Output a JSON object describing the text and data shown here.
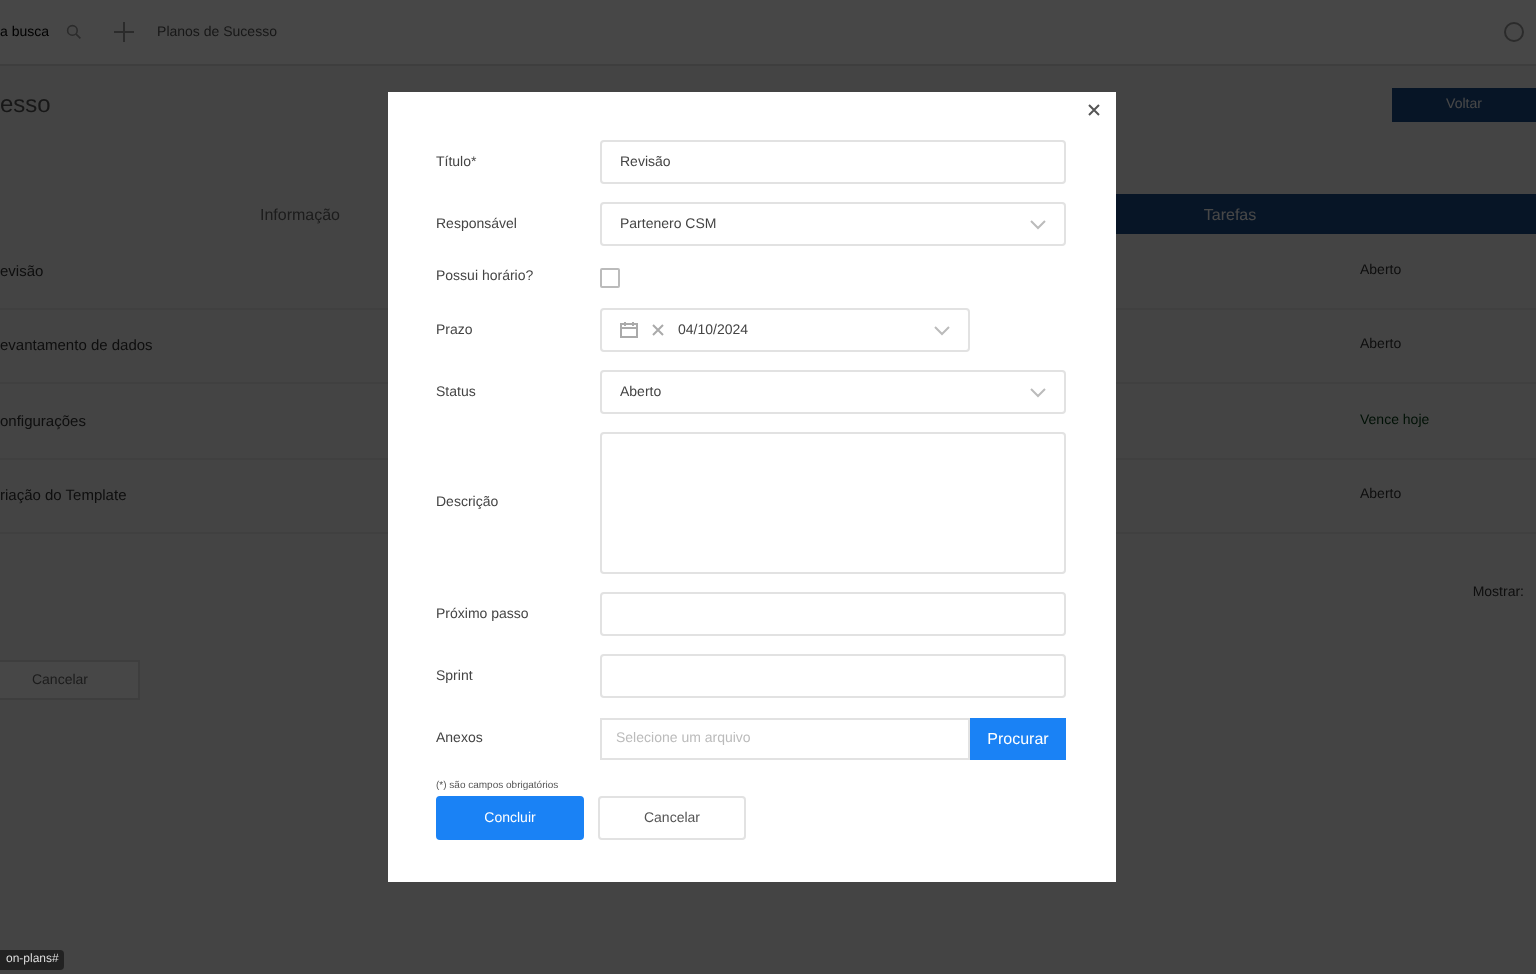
{
  "header": {
    "search_text": "a busca",
    "breadcrumb": "Planos de Sucesso"
  },
  "page": {
    "title": "esso",
    "back_button": "Voltar",
    "tabs": [
      {
        "label": "Informação",
        "selected": false
      },
      {
        "label": "Tarefas",
        "selected": true
      }
    ],
    "tasks": [
      {
        "name": "evisão",
        "status": "Aberto",
        "kind": "open"
      },
      {
        "name": "evantamento de dados",
        "status": "Aberto",
        "kind": "open"
      },
      {
        "name": "onfigurações",
        "status": "Vence hoje",
        "kind": "due"
      },
      {
        "name": "riação do Template",
        "status": "Aberto",
        "kind": "open"
      }
    ],
    "show_label": "Mostrar:",
    "cancel_button": "Cancelar"
  },
  "modal": {
    "fields": [
      {
        "kind": "text",
        "label": "Título*",
        "value": "Revisão"
      },
      {
        "kind": "select",
        "label": "Responsável",
        "value": "Partenero CSM"
      },
      {
        "kind": "checkbox",
        "label": "Possui horário?",
        "checked": false
      },
      {
        "kind": "date",
        "label": "Prazo",
        "value": "04/10/2024"
      },
      {
        "kind": "select",
        "label": "Status",
        "value": "Aberto"
      },
      {
        "kind": "textarea",
        "label": "Descrição"
      },
      {
        "kind": "text",
        "label": "Próximo passo"
      },
      {
        "kind": "text",
        "label": "Sprint"
      },
      {
        "kind": "file",
        "label": "Anexos",
        "placeholder": "Selecione um arquivo",
        "button": "Procurar"
      }
    ],
    "required_note": "(*) são campos obrigatórios",
    "buttons": [
      {
        "label": "Concluir",
        "kind": "primary"
      },
      {
        "label": "Cancelar",
        "kind": "secondary"
      }
    ]
  },
  "status_bar": "on-plans#"
}
